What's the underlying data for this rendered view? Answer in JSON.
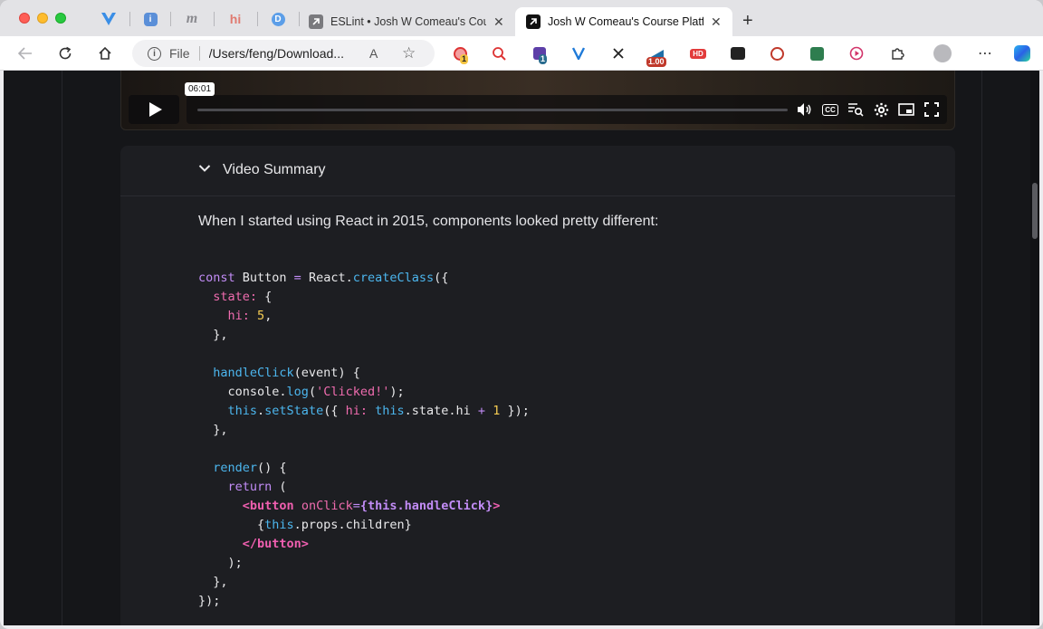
{
  "browser": {
    "tabs": [
      {
        "title": "ESLint • Josh W Comeau's Course Platform",
        "active": false,
        "favicon": "arrow-box-icon"
      },
      {
        "title": "Josh W Comeau's Course Platform",
        "active": true,
        "favicon": "arrow-box-icon"
      }
    ],
    "pinned_tab_glyphs": [
      "V",
      "i",
      "m",
      "hi",
      "D"
    ],
    "new_tab_symbol": "+",
    "address": {
      "scheme_label": "File",
      "url": "/Users/feng/Download...",
      "reader_symbol": "A"
    },
    "extension_badges": {
      "first_count": "1",
      "second_count": "1",
      "speed": "1.00",
      "hd": "HD"
    }
  },
  "video": {
    "timestamp_tooltip": "06:01"
  },
  "summary": {
    "heading": "Video Summary",
    "intro": "When I started using React in 2015, components looked pretty different:"
  },
  "code_lines": [
    "const Button = React.createClass({",
    "  state: {",
    "    hi: 5,",
    "  },",
    "",
    "  handleClick(event) {",
    "    console.log('Clicked!');",
    "    this.setState({ hi: this.state.hi + 1 });",
    "  },",
    "",
    "  render() {",
    "    return (",
    "      <button onClick={this.handleClick}>",
    "        {this.props.children}",
    "      </button>",
    "    );",
    "  },",
    "});"
  ],
  "colors": {
    "page_bg": "#151619",
    "panel_bg": "#1d1e22",
    "keyword": "#c28cf6",
    "function": "#4cb6ee",
    "property": "#f06caf",
    "number": "#f5cc52"
  }
}
